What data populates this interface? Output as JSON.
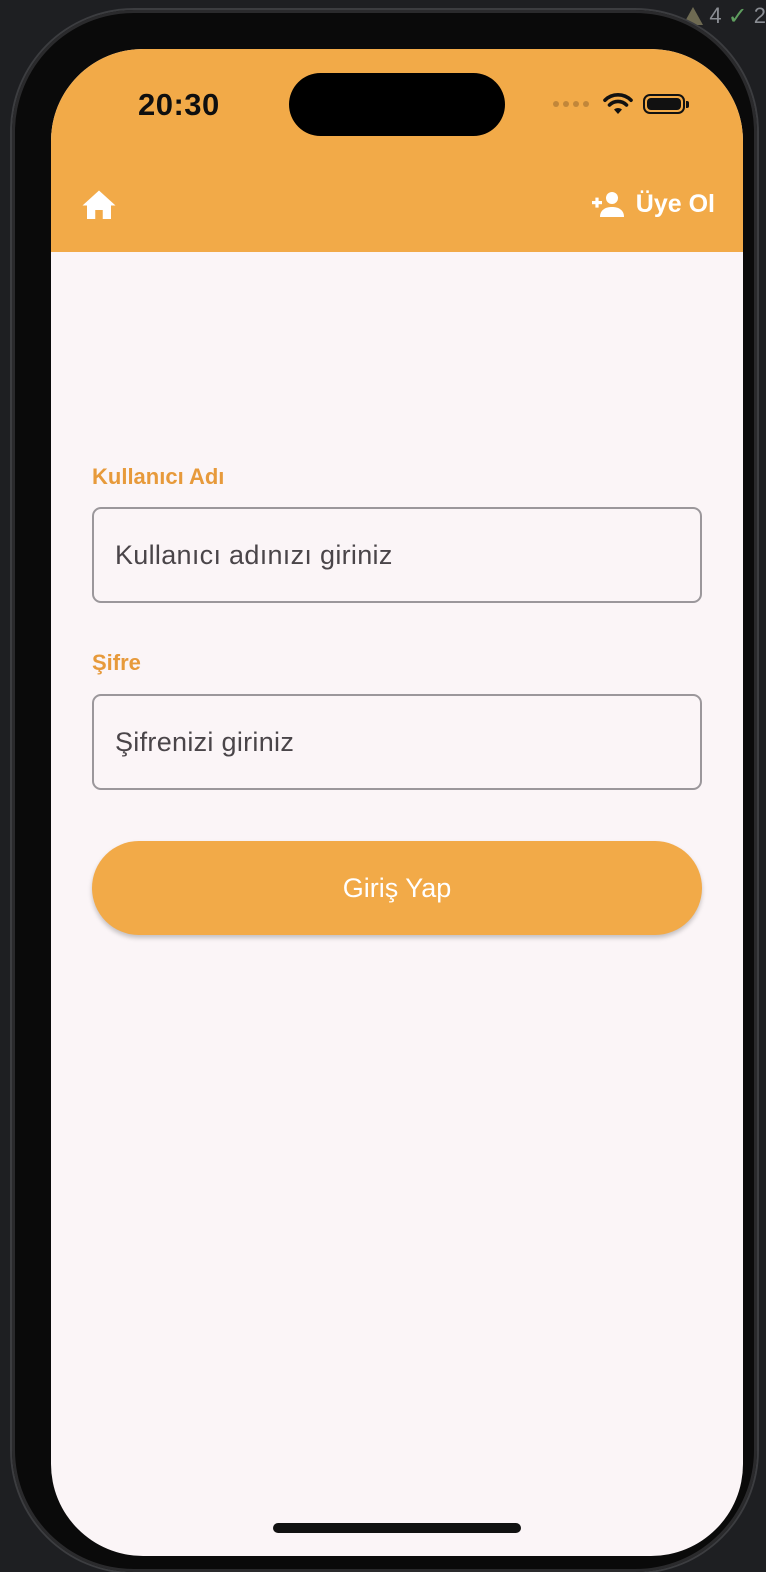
{
  "ide": {
    "warning_count": "4",
    "ok_count": "2"
  },
  "status_bar": {
    "time": "20:30"
  },
  "app_bar": {
    "home_icon": "home-icon",
    "signup_icon": "person-add-icon",
    "signup_label": "Üye Ol"
  },
  "form": {
    "username_label": "Kullanıcı Adı",
    "username_placeholder": "Kullanıcı adınızı giriniz",
    "password_label": "Şifre",
    "password_placeholder": "Şifrenizi giriniz",
    "login_label": "Giriş Yap"
  },
  "colors": {
    "accent": "#f2aa48",
    "label": "#e79a3b",
    "background": "#fbf5f7"
  }
}
